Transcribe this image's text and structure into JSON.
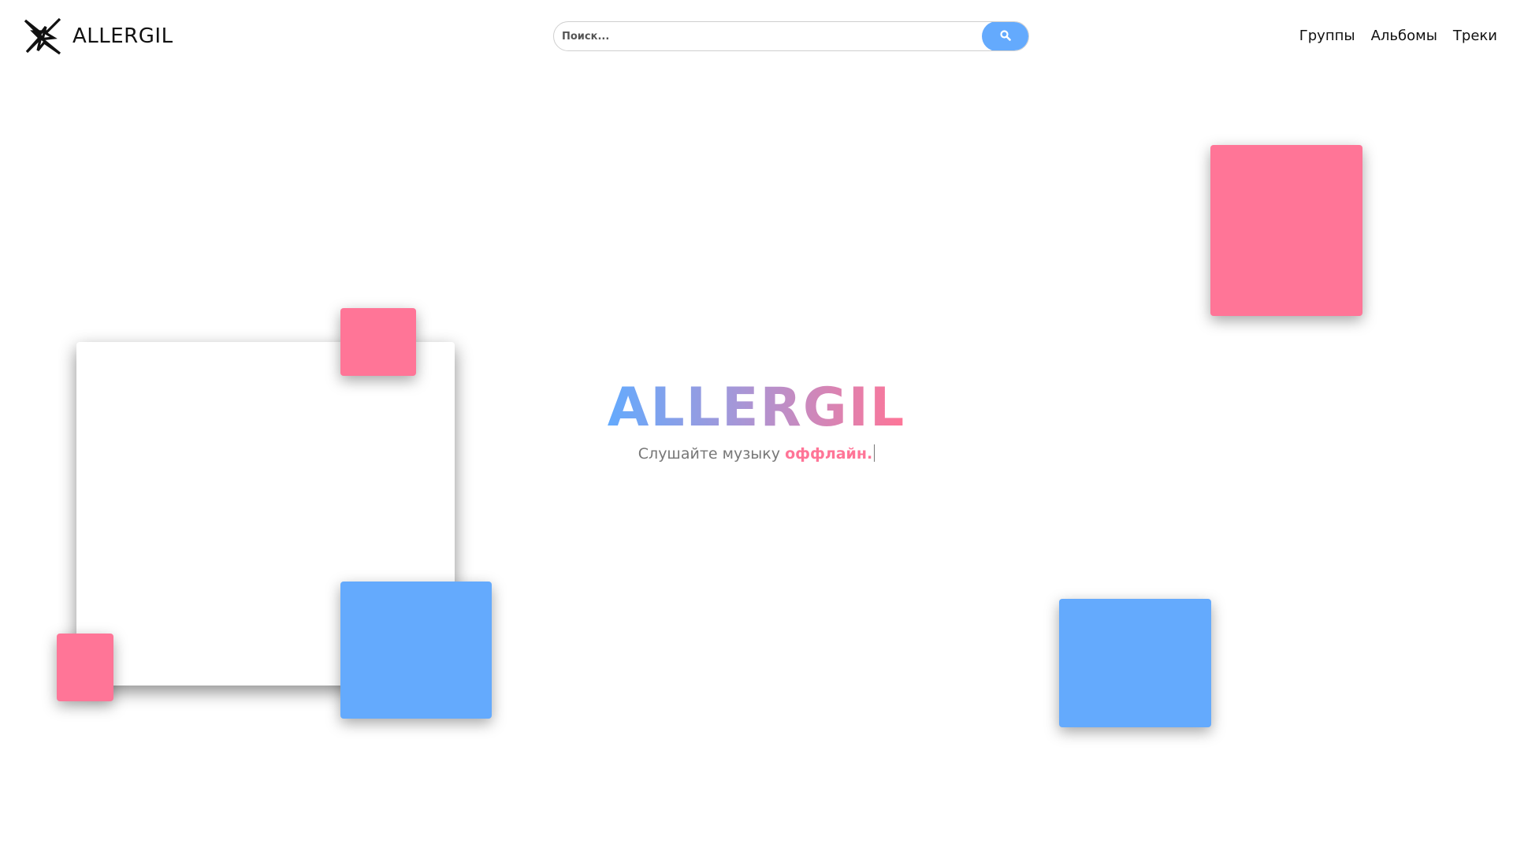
{
  "header": {
    "brand_name": "ALLERGIL",
    "logo_icon": "star-logo-icon",
    "search": {
      "placeholder": "Поиск...",
      "value": "",
      "button_icon": "search-icon"
    },
    "nav": [
      {
        "label": "Группы"
      },
      {
        "label": "Альбомы"
      },
      {
        "label": "Треки"
      }
    ]
  },
  "hero": {
    "title": "ALLERGIL",
    "subtitle_prefix": "Слушайте музыку ",
    "subtitle_accent": "оффлайн."
  },
  "colors": {
    "accent_blue": "#64aafd",
    "accent_pink": "#ff7597",
    "background": "#ffffff"
  }
}
